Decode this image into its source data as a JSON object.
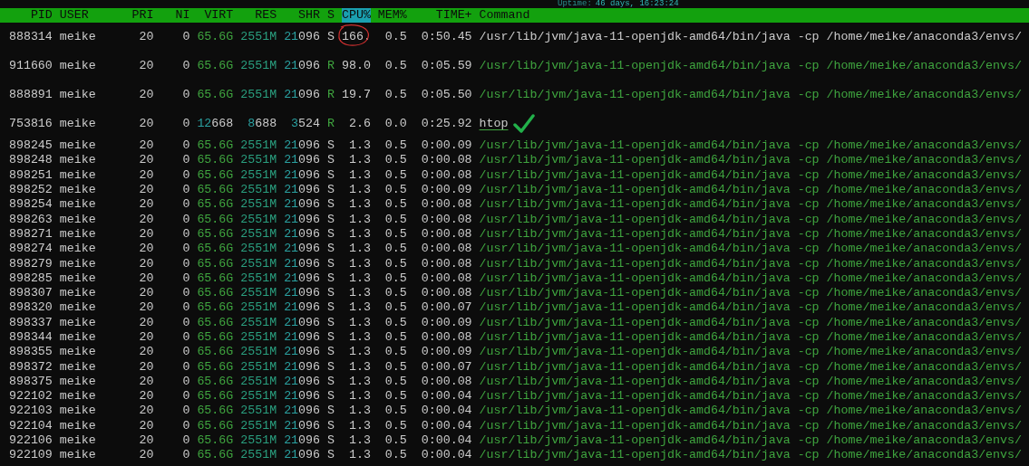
{
  "uptime": {
    "label": "Uptime:",
    "value": "46 days, 16:23:24"
  },
  "header": [
    {
      "label": "PID",
      "sorted": false
    },
    {
      "label": "USER",
      "sorted": false
    },
    {
      "label": "PRI",
      "sorted": false
    },
    {
      "label": "NI",
      "sorted": false
    },
    {
      "label": "VIRT",
      "sorted": false
    },
    {
      "label": "RES",
      "sorted": false
    },
    {
      "label": "SHR",
      "sorted": false
    },
    {
      "label": "S",
      "sorted": false
    },
    {
      "label": "CPU%",
      "sorted": true
    },
    {
      "label": "MEM%",
      "sorted": false
    },
    {
      "label": "TIME+",
      "sorted": false
    },
    {
      "label": "Command",
      "sorted": false
    }
  ],
  "rows": [
    {
      "pid": "888314",
      "user": "meike",
      "pri": "20",
      "ni": "0",
      "virt": "65.6G",
      "res": "2551M",
      "shr": "21096",
      "s": "S",
      "cpu": "166.",
      "mem": "0.5",
      "time": "0:50.45",
      "command": "/usr/lib/jvm/java-11-openjdk-amd64/bin/java -cp /home/meike/anaconda3/envs/",
      "thread": false,
      "cpu_circled": true,
      "command_checked": false
    },
    {
      "pid": "911660",
      "user": "meike",
      "pri": "20",
      "ni": "0",
      "virt": "65.6G",
      "res": "2551M",
      "shr": "21096",
      "s": "R",
      "cpu": "98.0",
      "mem": "0.5",
      "time": "0:05.59",
      "command": "/usr/lib/jvm/java-11-openjdk-amd64/bin/java -cp /home/meike/anaconda3/envs/",
      "thread": true,
      "cpu_circled": false,
      "command_checked": false
    },
    {
      "pid": "888891",
      "user": "meike",
      "pri": "20",
      "ni": "0",
      "virt": "65.6G",
      "res": "2551M",
      "shr": "21096",
      "s": "R",
      "cpu": "19.7",
      "mem": "0.5",
      "time": "0:05.50",
      "command": "/usr/lib/jvm/java-11-openjdk-amd64/bin/java -cp /home/meike/anaconda3/envs/",
      "thread": true,
      "cpu_circled": false,
      "command_checked": false
    },
    {
      "pid": "753816",
      "user": "meike",
      "pri": "20",
      "ni": "0",
      "virt": "12668",
      "res": "8688",
      "shr": "3524",
      "s": "R",
      "cpu": "2.6",
      "mem": "0.0",
      "time": "0:25.92",
      "command": "htop",
      "thread": false,
      "cpu_circled": false,
      "command_checked": true
    },
    {
      "pid": "898245",
      "user": "meike",
      "pri": "20",
      "ni": "0",
      "virt": "65.6G",
      "res": "2551M",
      "shr": "21096",
      "s": "S",
      "cpu": "1.3",
      "mem": "0.5",
      "time": "0:00.09",
      "command": "/usr/lib/jvm/java-11-openjdk-amd64/bin/java -cp /home/meike/anaconda3/envs/",
      "thread": true,
      "cpu_circled": false,
      "command_checked": false
    },
    {
      "pid": "898248",
      "user": "meike",
      "pri": "20",
      "ni": "0",
      "virt": "65.6G",
      "res": "2551M",
      "shr": "21096",
      "s": "S",
      "cpu": "1.3",
      "mem": "0.5",
      "time": "0:00.08",
      "command": "/usr/lib/jvm/java-11-openjdk-amd64/bin/java -cp /home/meike/anaconda3/envs/",
      "thread": true,
      "cpu_circled": false,
      "command_checked": false
    },
    {
      "pid": "898251",
      "user": "meike",
      "pri": "20",
      "ni": "0",
      "virt": "65.6G",
      "res": "2551M",
      "shr": "21096",
      "s": "S",
      "cpu": "1.3",
      "mem": "0.5",
      "time": "0:00.08",
      "command": "/usr/lib/jvm/java-11-openjdk-amd64/bin/java -cp /home/meike/anaconda3/envs/",
      "thread": true,
      "cpu_circled": false,
      "command_checked": false
    },
    {
      "pid": "898252",
      "user": "meike",
      "pri": "20",
      "ni": "0",
      "virt": "65.6G",
      "res": "2551M",
      "shr": "21096",
      "s": "S",
      "cpu": "1.3",
      "mem": "0.5",
      "time": "0:00.09",
      "command": "/usr/lib/jvm/java-11-openjdk-amd64/bin/java -cp /home/meike/anaconda3/envs/",
      "thread": true,
      "cpu_circled": false,
      "command_checked": false
    },
    {
      "pid": "898254",
      "user": "meike",
      "pri": "20",
      "ni": "0",
      "virt": "65.6G",
      "res": "2551M",
      "shr": "21096",
      "s": "S",
      "cpu": "1.3",
      "mem": "0.5",
      "time": "0:00.08",
      "command": "/usr/lib/jvm/java-11-openjdk-amd64/bin/java -cp /home/meike/anaconda3/envs/",
      "thread": true,
      "cpu_circled": false,
      "command_checked": false
    },
    {
      "pid": "898263",
      "user": "meike",
      "pri": "20",
      "ni": "0",
      "virt": "65.6G",
      "res": "2551M",
      "shr": "21096",
      "s": "S",
      "cpu": "1.3",
      "mem": "0.5",
      "time": "0:00.08",
      "command": "/usr/lib/jvm/java-11-openjdk-amd64/bin/java -cp /home/meike/anaconda3/envs/",
      "thread": true,
      "cpu_circled": false,
      "command_checked": false
    },
    {
      "pid": "898271",
      "user": "meike",
      "pri": "20",
      "ni": "0",
      "virt": "65.6G",
      "res": "2551M",
      "shr": "21096",
      "s": "S",
      "cpu": "1.3",
      "mem": "0.5",
      "time": "0:00.08",
      "command": "/usr/lib/jvm/java-11-openjdk-amd64/bin/java -cp /home/meike/anaconda3/envs/",
      "thread": true,
      "cpu_circled": false,
      "command_checked": false
    },
    {
      "pid": "898274",
      "user": "meike",
      "pri": "20",
      "ni": "0",
      "virt": "65.6G",
      "res": "2551M",
      "shr": "21096",
      "s": "S",
      "cpu": "1.3",
      "mem": "0.5",
      "time": "0:00.08",
      "command": "/usr/lib/jvm/java-11-openjdk-amd64/bin/java -cp /home/meike/anaconda3/envs/",
      "thread": true,
      "cpu_circled": false,
      "command_checked": false
    },
    {
      "pid": "898279",
      "user": "meike",
      "pri": "20",
      "ni": "0",
      "virt": "65.6G",
      "res": "2551M",
      "shr": "21096",
      "s": "S",
      "cpu": "1.3",
      "mem": "0.5",
      "time": "0:00.08",
      "command": "/usr/lib/jvm/java-11-openjdk-amd64/bin/java -cp /home/meike/anaconda3/envs/",
      "thread": true,
      "cpu_circled": false,
      "command_checked": false
    },
    {
      "pid": "898285",
      "user": "meike",
      "pri": "20",
      "ni": "0",
      "virt": "65.6G",
      "res": "2551M",
      "shr": "21096",
      "s": "S",
      "cpu": "1.3",
      "mem": "0.5",
      "time": "0:00.08",
      "command": "/usr/lib/jvm/java-11-openjdk-amd64/bin/java -cp /home/meike/anaconda3/envs/",
      "thread": true,
      "cpu_circled": false,
      "command_checked": false
    },
    {
      "pid": "898307",
      "user": "meike",
      "pri": "20",
      "ni": "0",
      "virt": "65.6G",
      "res": "2551M",
      "shr": "21096",
      "s": "S",
      "cpu": "1.3",
      "mem": "0.5",
      "time": "0:00.08",
      "command": "/usr/lib/jvm/java-11-openjdk-amd64/bin/java -cp /home/meike/anaconda3/envs/",
      "thread": true,
      "cpu_circled": false,
      "command_checked": false
    },
    {
      "pid": "898320",
      "user": "meike",
      "pri": "20",
      "ni": "0",
      "virt": "65.6G",
      "res": "2551M",
      "shr": "21096",
      "s": "S",
      "cpu": "1.3",
      "mem": "0.5",
      "time": "0:00.07",
      "command": "/usr/lib/jvm/java-11-openjdk-amd64/bin/java -cp /home/meike/anaconda3/envs/",
      "thread": true,
      "cpu_circled": false,
      "command_checked": false
    },
    {
      "pid": "898337",
      "user": "meike",
      "pri": "20",
      "ni": "0",
      "virt": "65.6G",
      "res": "2551M",
      "shr": "21096",
      "s": "S",
      "cpu": "1.3",
      "mem": "0.5",
      "time": "0:00.09",
      "command": "/usr/lib/jvm/java-11-openjdk-amd64/bin/java -cp /home/meike/anaconda3/envs/",
      "thread": true,
      "cpu_circled": false,
      "command_checked": false
    },
    {
      "pid": "898344",
      "user": "meike",
      "pri": "20",
      "ni": "0",
      "virt": "65.6G",
      "res": "2551M",
      "shr": "21096",
      "s": "S",
      "cpu": "1.3",
      "mem": "0.5",
      "time": "0:00.08",
      "command": "/usr/lib/jvm/java-11-openjdk-amd64/bin/java -cp /home/meike/anaconda3/envs/",
      "thread": true,
      "cpu_circled": false,
      "command_checked": false
    },
    {
      "pid": "898355",
      "user": "meike",
      "pri": "20",
      "ni": "0",
      "virt": "65.6G",
      "res": "2551M",
      "shr": "21096",
      "s": "S",
      "cpu": "1.3",
      "mem": "0.5",
      "time": "0:00.09",
      "command": "/usr/lib/jvm/java-11-openjdk-amd64/bin/java -cp /home/meike/anaconda3/envs/",
      "thread": true,
      "cpu_circled": false,
      "command_checked": false
    },
    {
      "pid": "898372",
      "user": "meike",
      "pri": "20",
      "ni": "0",
      "virt": "65.6G",
      "res": "2551M",
      "shr": "21096",
      "s": "S",
      "cpu": "1.3",
      "mem": "0.5",
      "time": "0:00.07",
      "command": "/usr/lib/jvm/java-11-openjdk-amd64/bin/java -cp /home/meike/anaconda3/envs/",
      "thread": true,
      "cpu_circled": false,
      "command_checked": false
    },
    {
      "pid": "898375",
      "user": "meike",
      "pri": "20",
      "ni": "0",
      "virt": "65.6G",
      "res": "2551M",
      "shr": "21096",
      "s": "S",
      "cpu": "1.3",
      "mem": "0.5",
      "time": "0:00.08",
      "command": "/usr/lib/jvm/java-11-openjdk-amd64/bin/java -cp /home/meike/anaconda3/envs/",
      "thread": true,
      "cpu_circled": false,
      "command_checked": false
    },
    {
      "pid": "922102",
      "user": "meike",
      "pri": "20",
      "ni": "0",
      "virt": "65.6G",
      "res": "2551M",
      "shr": "21096",
      "s": "S",
      "cpu": "1.3",
      "mem": "0.5",
      "time": "0:00.04",
      "command": "/usr/lib/jvm/java-11-openjdk-amd64/bin/java -cp /home/meike/anaconda3/envs/",
      "thread": true,
      "cpu_circled": false,
      "command_checked": false
    },
    {
      "pid": "922103",
      "user": "meike",
      "pri": "20",
      "ni": "0",
      "virt": "65.6G",
      "res": "2551M",
      "shr": "21096",
      "s": "S",
      "cpu": "1.3",
      "mem": "0.5",
      "time": "0:00.04",
      "command": "/usr/lib/jvm/java-11-openjdk-amd64/bin/java -cp /home/meike/anaconda3/envs/",
      "thread": true,
      "cpu_circled": false,
      "command_checked": false
    },
    {
      "pid": "922104",
      "user": "meike",
      "pri": "20",
      "ni": "0",
      "virt": "65.6G",
      "res": "2551M",
      "shr": "21096",
      "s": "S",
      "cpu": "1.3",
      "mem": "0.5",
      "time": "0:00.04",
      "command": "/usr/lib/jvm/java-11-openjdk-amd64/bin/java -cp /home/meike/anaconda3/envs/",
      "thread": true,
      "cpu_circled": false,
      "command_checked": false
    },
    {
      "pid": "922106",
      "user": "meike",
      "pri": "20",
      "ni": "0",
      "virt": "65.6G",
      "res": "2551M",
      "shr": "21096",
      "s": "S",
      "cpu": "1.3",
      "mem": "0.5",
      "time": "0:00.04",
      "command": "/usr/lib/jvm/java-11-openjdk-amd64/bin/java -cp /home/meike/anaconda3/envs/",
      "thread": true,
      "cpu_circled": false,
      "command_checked": false
    },
    {
      "pid": "922109",
      "user": "meike",
      "pri": "20",
      "ni": "0",
      "virt": "65.6G",
      "res": "2551M",
      "shr": "21096",
      "s": "S",
      "cpu": "1.3",
      "mem": "0.5",
      "time": "0:00.04",
      "command": "/usr/lib/jvm/java-11-openjdk-amd64/bin/java -cp /home/meike/anaconda3/envs/",
      "thread": true,
      "cpu_circled": false,
      "command_checked": false
    }
  ]
}
